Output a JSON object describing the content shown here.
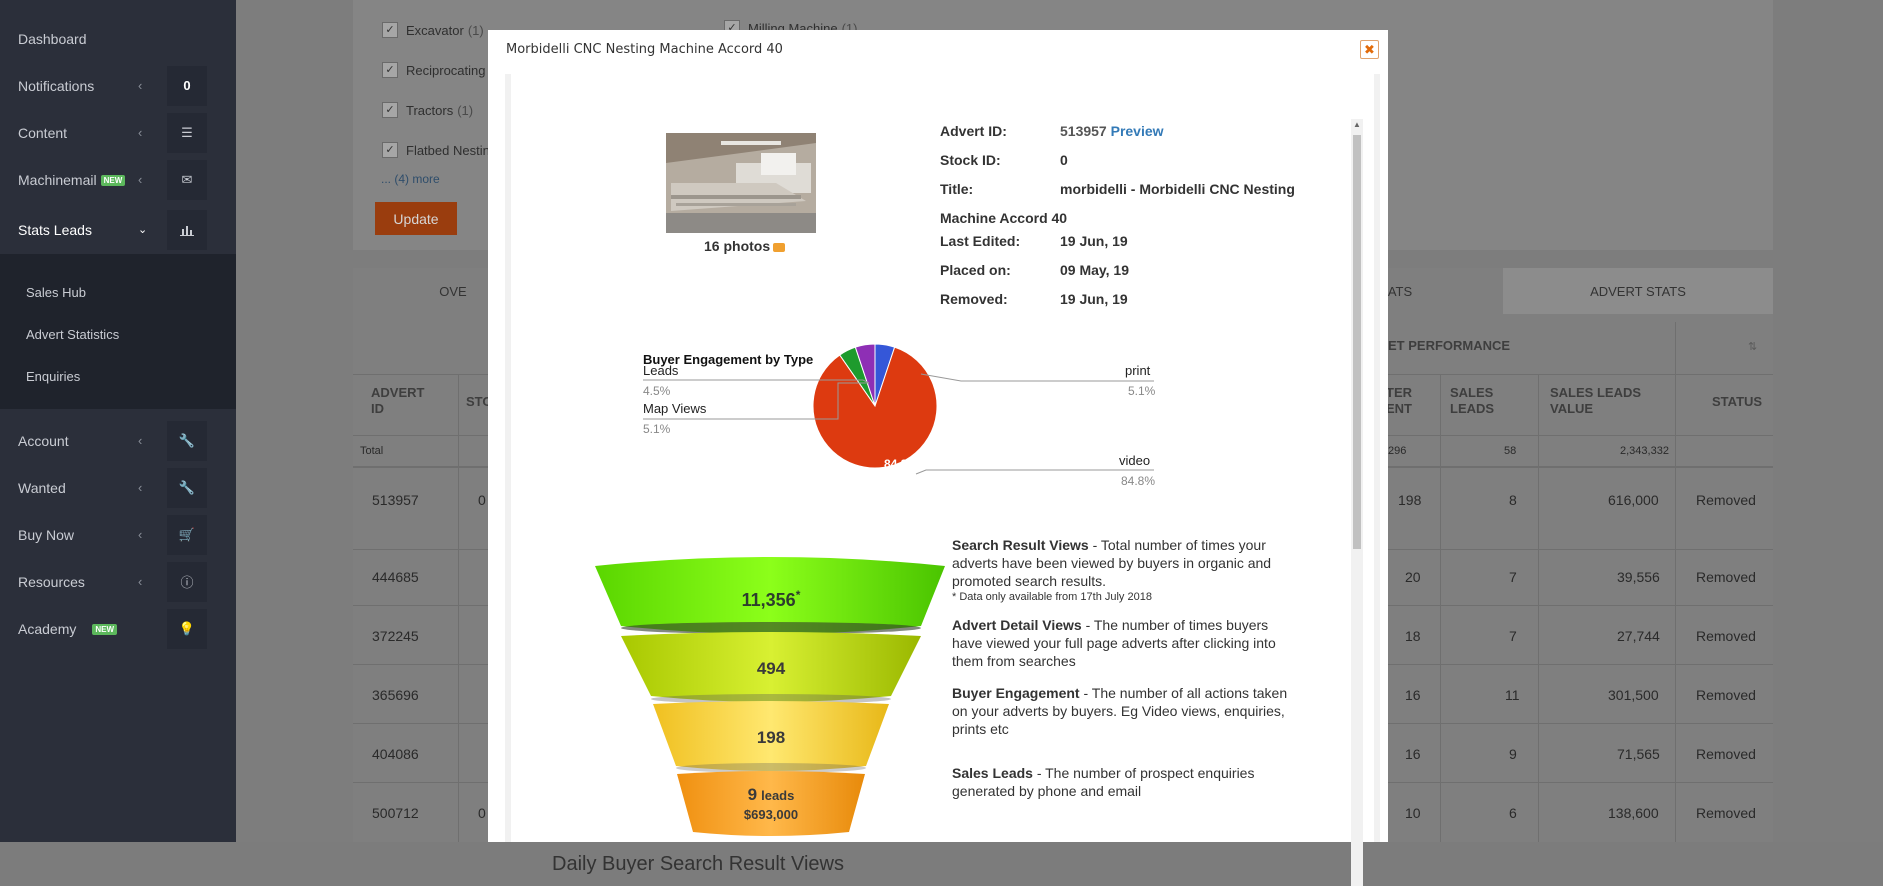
{
  "sidebar": {
    "items": [
      {
        "label": "Dashboard",
        "icon": ""
      },
      {
        "label": "Notifications",
        "icon": "",
        "box": "0"
      },
      {
        "label": "Content",
        "icon": "list-icon"
      },
      {
        "label": "Machinemail",
        "badge": "NEW",
        "icon": "envelope-icon"
      },
      {
        "label": "Stats Leads",
        "icon": "bar-chart-icon"
      },
      {
        "label": "Account",
        "icon": "wrench-icon"
      },
      {
        "label": "Wanted",
        "icon": "wrench-icon"
      },
      {
        "label": "Buy Now",
        "icon": "cart-icon"
      },
      {
        "label": "Resources",
        "icon": "info-icon"
      },
      {
        "label": "Academy",
        "badge": "NEW",
        "icon": "lightbulb-icon"
      }
    ],
    "submenu": [
      "Sales Hub",
      "Advert Statistics",
      "Enquiries"
    ]
  },
  "background": {
    "filters": [
      {
        "label": "Excavator",
        "count": "(1)"
      },
      {
        "label": "Reciprocating",
        "count": ""
      },
      {
        "label": "Tractors",
        "count": "(1)"
      },
      {
        "label": "Flatbed Nestin",
        "count": ""
      },
      {
        "label": "Milling Machine",
        "count": "(1)"
      }
    ],
    "more_link": "... (4) more",
    "update_button": "Update",
    "tabs": [
      "OVE",
      "ATS",
      "ADVERT STATS"
    ],
    "group_header": "ET PERFORMANCE",
    "columns": {
      "advert_id": "ADVERT ID",
      "stock": "STO",
      "ter": "TER ENT",
      "sales_leads": "SALES LEADS",
      "sales_leads_value": "SALES LEADS VALUE",
      "status": "STATUS"
    },
    "total_row": {
      "label": "Total",
      "ter": "296",
      "sales_leads": "58",
      "value": "2,343,332"
    },
    "rows": [
      {
        "advert_id": "513957",
        "stock": "0",
        "ter": "198",
        "leads": "8",
        "value": "616,000",
        "status": "Removed"
      },
      {
        "advert_id": "444685",
        "stock": "",
        "ter": "20",
        "leads": "7",
        "value": "39,556",
        "status": "Removed"
      },
      {
        "advert_id": "372245",
        "stock": "",
        "ter": "18",
        "leads": "7",
        "value": "27,744",
        "status": "Removed"
      },
      {
        "advert_id": "365696",
        "stock": "",
        "ter": "16",
        "leads": "11",
        "value": "301,500",
        "status": "Removed"
      },
      {
        "advert_id": "404086",
        "stock": "",
        "ter": "16",
        "leads": "9",
        "value": "71,565",
        "status": "Removed"
      },
      {
        "advert_id": "500712",
        "stock": "0",
        "ter": "10",
        "leads": "6",
        "value": "138,600",
        "status": "Removed"
      }
    ]
  },
  "modal": {
    "title": "Morbidelli CNC Nesting Machine Accord 40",
    "close_icon": "close-icon",
    "photos_label": "16 photos",
    "details": {
      "advert_id_label": "Advert ID:",
      "advert_id": "513957",
      "preview_link": "Preview",
      "stock_id_label": "Stock ID:",
      "stock_id": "0",
      "title_label": "Title:",
      "title_line1": "morbidelli - Morbidelli CNC Nesting",
      "title_line2": "Machine Accord 40",
      "last_edited_label": "Last Edited:",
      "last_edited": "19 Jun, 19",
      "placed_on_label": "Placed on:",
      "placed_on": "09 May, 19",
      "removed_label": "Removed:",
      "removed": "19 Jun, 19"
    },
    "funnel": {
      "search_views": "11,356",
      "search_views_mark": "*",
      "detail_views": "494",
      "engagement": "198",
      "leads_count": "9",
      "leads_word": "leads",
      "leads_value": "$693,000"
    },
    "descriptions": [
      {
        "title": "Search Result Views",
        "text": " - Total number of times your adverts have been viewed by buyers in organic and promoted search results."
      },
      {
        "title": "Advert Detail Views",
        "text": " - The number of times buyers have viewed your full page adverts after clicking into them from searches"
      },
      {
        "title": "Buyer Engagement",
        "text": " - The number of all actions taken on your adverts by buyers. Eg Video views, enquiries, prints etc"
      },
      {
        "title": "Sales Leads",
        "text": " - The number of prospect enquiries generated by phone and email"
      }
    ],
    "footnote": "* Data only available from 17th July 2018",
    "daily_title": "Daily Buyer Search Result Views"
  },
  "chart_data": {
    "type": "pie",
    "title": "Buyer Engagement by Type",
    "categories": [
      "Leads",
      "Map Views",
      "print",
      "video"
    ],
    "values": [
      4.5,
      5.1,
      5.1,
      84.8
    ],
    "labels": [
      "4.5%",
      "5.1%",
      "5.1%",
      "84.8%"
    ],
    "inner_label": "84.8%",
    "colors": [
      "#1e9b2d",
      "#8e2fb5",
      "#3557d8",
      "#dd3a10"
    ]
  }
}
